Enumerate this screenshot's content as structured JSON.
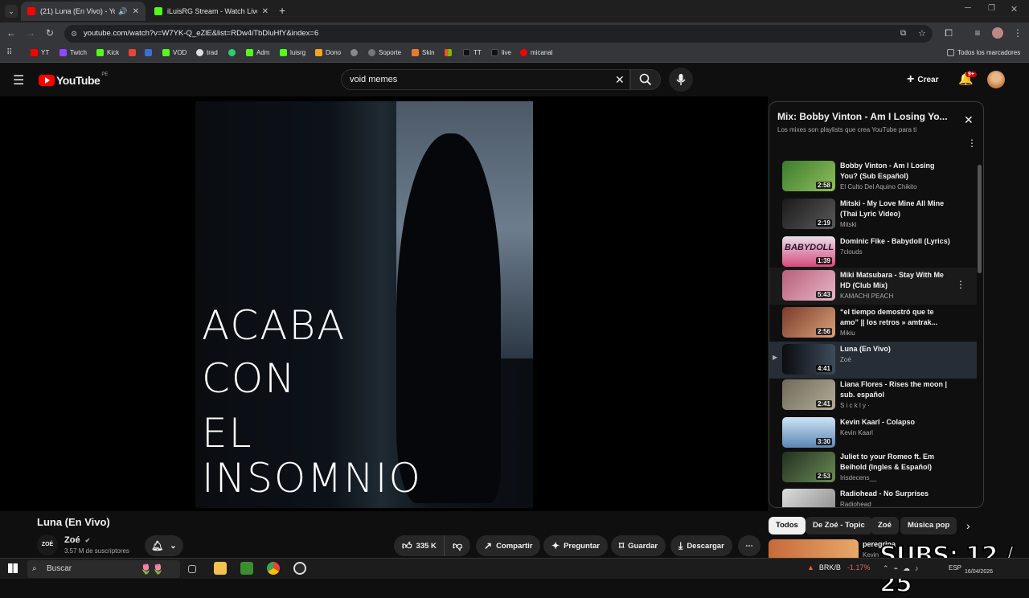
{
  "browser": {
    "tabs": [
      {
        "title": "(21) Luna (En Vivo) - YouTu"
      },
      {
        "title": "iLuisRG Stream - Watch Live on"
      }
    ],
    "url": "youtube.com/watch?v=W7YK-Q_eZlE&list=RDw4iTbDluHfY&index=6",
    "bookmarks": [
      "YT",
      "Twtch",
      "Kick",
      "VOD",
      "trad",
      "Adm",
      "luisrg",
      "Dono",
      "Soporte",
      "Skin",
      "TT",
      "live",
      "micanal"
    ],
    "all_bookmarks": "Todos los marcadores"
  },
  "youtube": {
    "logo": "YouTube",
    "region": "PE",
    "search_value": "void memes",
    "create_label": "Crear",
    "notif_count": "9+"
  },
  "video": {
    "overlay_lines": [
      "ACABA",
      "CON",
      "EL",
      "INSOMNIO"
    ],
    "title": "Luna (En Vivo)",
    "channel": "Zoé",
    "channel_avatar": "ZOÉ",
    "subscribers": "3.57 M de suscriptores",
    "likes": "335 K",
    "actions": {
      "share": "Compartir",
      "ask": "Preguntar",
      "save": "Guardar",
      "download": "Descargar"
    }
  },
  "playlist": {
    "title": "Mix: Bobby Vinton - Am I Losing Yo...",
    "subtitle": "Los mixes son playlists que crea YouTube para ti",
    "items": [
      {
        "title": "Bobby Vinton - Am I Losing You? (Sub Español)",
        "channel": "El Culto Del Aquino Chikito",
        "duration": "2:58"
      },
      {
        "title": "Mitski - My Love Mine All Mine (Thai Lyric Video)",
        "channel": "Mitski",
        "duration": "2:19"
      },
      {
        "title": "Dominic Fike - Babydoll (Lyrics)",
        "channel": "7clouds",
        "duration": "1:39"
      },
      {
        "title": "Miki Matsubara - Stay With Me HD (Club Mix)",
        "channel": "KAMACHI PEACH",
        "duration": "5:43"
      },
      {
        "title": "“el tiempo demostró que te amo” || los retros » amtrak...",
        "channel": "Mikiu",
        "duration": "2:56"
      },
      {
        "title": "Luna (En Vivo)",
        "channel": "Zoé",
        "duration": "4:41"
      },
      {
        "title": "Liana Flores - Rises the moon | sub. español",
        "channel": "S i c k l y ·",
        "duration": "2:41"
      },
      {
        "title": "Kevin Kaarl - Colapso",
        "channel": "Kevin Kaarl",
        "duration": "3:30"
      },
      {
        "title": "Juliet to your Romeo ft. Em Beihold (Ingles & Español)",
        "channel": "Irisdecens__",
        "duration": "2:53"
      },
      {
        "title": "Radiohead - No Surprises",
        "channel": "Radiohead",
        "duration": ""
      }
    ],
    "thumb_text_babydoll": "BABYDOLL"
  },
  "chips": [
    "Todos",
    "De Zoé - Topic",
    "Zoé",
    "Música pop"
  ],
  "next_video": {
    "title": "peregrina",
    "channel": "Kevin"
  },
  "taskbar": {
    "search": "Buscar",
    "ticker": "BRK/B",
    "ticker_change": "-1.17%",
    "lang": "ESP",
    "date": "16/04/2026"
  },
  "overlay": {
    "subs": "SUBS: 12 / 25"
  }
}
